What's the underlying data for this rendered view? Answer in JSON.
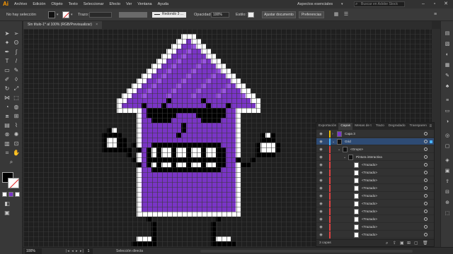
{
  "app": {
    "logo": "Ai"
  },
  "menu": [
    "Archivo",
    "Edición",
    "Objeto",
    "Texto",
    "Seleccionar",
    "Efecto",
    "Ver",
    "Ventana",
    "Ayuda"
  ],
  "workspace": "Aspectos esenciales",
  "search": {
    "placeholder": "Buscar en Adobe Stock"
  },
  "controlbar": {
    "selection": "No hay selección",
    "stroke_label": "Trazo:",
    "brush": "Redondo 3 ...",
    "opacity_label": "Opacidad:",
    "opacity_value": "100%",
    "style_label": "Estilo:",
    "doc_settings": "Ajustar documento",
    "preferences": "Preferencias"
  },
  "document": {
    "tab": "Sin título-1* al 100% (RGB/Previsualizar)",
    "close": "×"
  },
  "layers_panel": {
    "tabs": [
      "Exportación",
      "Capas",
      "Mesas de t",
      "Trazo",
      "Degradado",
      "Transparen"
    ],
    "active_tab": "Capas",
    "menu": "≡",
    "rows": [
      {
        "name": "Capa 3",
        "bar": "#f0c000",
        "thumb": "#7a38c8",
        "indent": 0,
        "expand": "›"
      },
      {
        "name": "Grid",
        "bar": "#4ab4ff",
        "thumb": "#111111",
        "indent": 0,
        "expand": "⌄",
        "selected": true
      },
      {
        "name": "<Grupo>",
        "bar": "#e04040",
        "thumb": "#111111",
        "indent": 1,
        "expand": "⌄"
      },
      {
        "name": "Pintura interactiva",
        "bar": "#e04040",
        "thumb": "#111111",
        "indent": 2,
        "expand": "⌄"
      },
      {
        "name": "<Trazado>",
        "bar": "#e04040",
        "thumb": "#ffffff",
        "indent": 3,
        "expand": ""
      },
      {
        "name": "<Trazado>",
        "bar": "#e04040",
        "thumb": "#ffffff",
        "indent": 3,
        "expand": ""
      },
      {
        "name": "<Trazado>",
        "bar": "#e04040",
        "thumb": "#ffffff",
        "indent": 3,
        "expand": ""
      },
      {
        "name": "<Trazado>",
        "bar": "#e04040",
        "thumb": "#ffffff",
        "indent": 3,
        "expand": ""
      },
      {
        "name": "<Trazado>",
        "bar": "#e04040",
        "thumb": "#ffffff",
        "indent": 3,
        "expand": ""
      },
      {
        "name": "<Trazado>",
        "bar": "#e04040",
        "thumb": "#ffffff",
        "indent": 3,
        "expand": ""
      },
      {
        "name": "<Trazado>",
        "bar": "#e04040",
        "thumb": "#ffffff",
        "indent": 3,
        "expand": ""
      },
      {
        "name": "<Trazado>",
        "bar": "#e04040",
        "thumb": "#ffffff",
        "indent": 3,
        "expand": ""
      },
      {
        "name": "<Trazado>",
        "bar": "#e04040",
        "thumb": "#ffffff",
        "indent": 3,
        "expand": ""
      },
      {
        "name": "<Trazado>",
        "bar": "#e04040",
        "thumb": "#ffffff",
        "indent": 3,
        "expand": ""
      }
    ],
    "footer": {
      "count": "3 capas"
    }
  },
  "statusbar": {
    "zoom": "100%",
    "artboard": "1",
    "tool": "Selección directa",
    "nav": "|◂ ◂ ▸ ▸|"
  },
  "colors": {
    "purple": "#7a34c6",
    "purple_light": "#9a55e0",
    "grid_line": "#3a3a3a",
    "canvas_bg": "#1f1f1f",
    "selection_blue": "#2e4b74"
  }
}
